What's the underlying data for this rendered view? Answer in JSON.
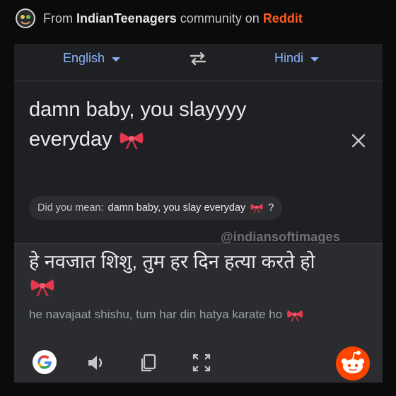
{
  "header": {
    "prefix": "From",
    "community": "IndianTeenagers",
    "middle": "community on",
    "site": "Reddit"
  },
  "translator": {
    "source_language": "English",
    "target_language": "Hindi",
    "source_text_line1": "damn baby, you slayyyy",
    "source_text_line2": "everyday",
    "did_you_mean_label": "Did you mean:",
    "did_you_mean_suggestion": "damn baby, you slay everyday",
    "did_you_mean_suffix": "?",
    "watermark": "@indiansoftimages",
    "translation_line1": "हे नवजात शिशु, तुम हर दिन हत्या करते हो",
    "transliteration": "he navajaat shishu, tum har din hatya karate ho"
  },
  "colors": {
    "accent_blue": "#8ab4f8",
    "reddit_orange": "#ff5a1f",
    "bow_red": "#e53950"
  },
  "icons": [
    "avatar",
    "chevron-down-icon",
    "swap-icon",
    "close-icon",
    "ribbon-emoji",
    "speaker-icon",
    "mic-icon",
    "camera-lens-icon",
    "google-logo",
    "copy-icon",
    "fullscreen-icon",
    "reddit-snoo-icon"
  ]
}
